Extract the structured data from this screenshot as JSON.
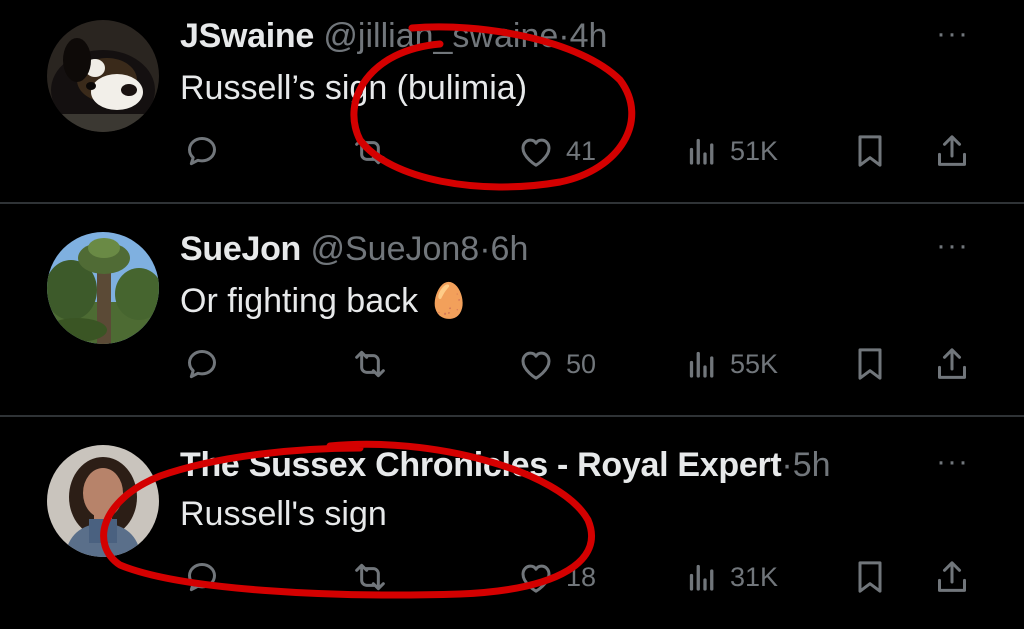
{
  "tweets": [
    {
      "display_name": "JSwaine",
      "handle": "@jillian_swaine",
      "dot": "·",
      "time": "4h",
      "text": "Russell’s sign (bulimia)",
      "likes": "41",
      "views": "51K",
      "more": "···"
    },
    {
      "display_name": "SueJon",
      "handle": "@SueJon8",
      "dot": "·",
      "time": "6h",
      "text": "Or fighting back",
      "emoji": "🥚",
      "likes": "50",
      "views": "55K",
      "more": "···"
    },
    {
      "display_name": "The Sussex Chronicles - Royal Expert",
      "dot": "·",
      "time": "5h",
      "text": "Russell's sign",
      "likes": "18",
      "views": "31K",
      "more": "···"
    }
  ],
  "icons": {
    "reply": "reply-icon",
    "retweet": "retweet-icon",
    "like": "heart-icon",
    "views": "views-icon",
    "bookmark": "bookmark-icon",
    "share": "share-icon"
  },
  "colors": {
    "background": "#000000",
    "text": "#e7e9ea",
    "muted": "#71767b",
    "divider": "#2f3336",
    "annotation": "#d40000"
  }
}
